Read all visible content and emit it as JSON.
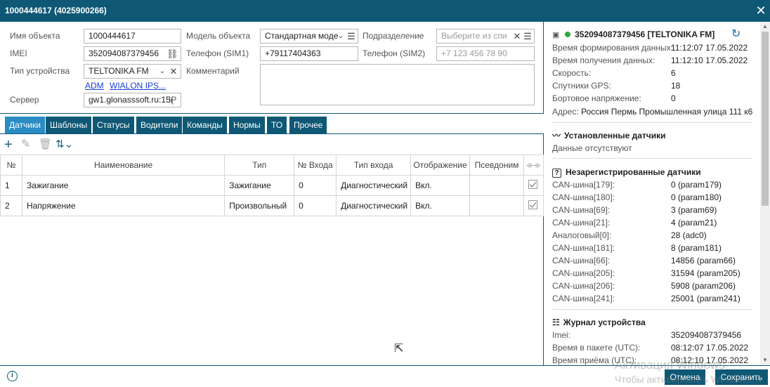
{
  "window": {
    "title": "1000444617 (4025900266)",
    "close": "✕"
  },
  "form": {
    "object_name_label": "Имя объекта",
    "object_name": "1000444617",
    "imei_label": "IMEI",
    "imei": "352094087379456",
    "device_type_label": "Тип устройства",
    "device_type": "TELTONIKA FM",
    "link_adm": "ADM",
    "link_wialon": "WIALON IPS...",
    "server_label": "Сервер",
    "server": "gw1.glonasssoft.ru:15(",
    "server_suffix": "IP",
    "model_label": "Модель объекта",
    "model": "Стандартная моде",
    "phone1_label": "Телефон (SIM1)",
    "phone1": "+79117404363",
    "comment_label": "Комментарий",
    "division_label": "Подразделение",
    "division_placeholder": "Выберите из спи",
    "phone2_label": "Телефон (SIM2)",
    "phone2_placeholder": "+7 123 456 78 90"
  },
  "tabs": [
    "Датчики",
    "Шаблоны",
    "Статусы",
    "Водители",
    "Команды",
    "Нормы",
    "ТО",
    "Прочее"
  ],
  "table": {
    "headers": [
      "№",
      "Наименование",
      "Тип",
      "№ Входа",
      "Тип входа",
      "Отображение",
      "Псевдоним"
    ],
    "rows": [
      [
        "1",
        "Зажигание",
        "Зажигание",
        "0",
        "Диагностический",
        "Вкл.",
        ""
      ],
      [
        "2",
        "Напряжение",
        "Произвольный",
        "0",
        "Диагностический",
        "Вкл.",
        ""
      ]
    ]
  },
  "right": {
    "device": "352094087379456 [TELTONIKA FM]",
    "status_color": "#2eaa3a",
    "info": [
      {
        "k": "Время формирования данных:",
        "v": "11:12:07 17.05.2022"
      },
      {
        "k": "Время получения данных:",
        "v": "11:12:10 17.05.2022"
      },
      {
        "k": "Скорость:",
        "v": "6"
      },
      {
        "k": "Спутники GPS:",
        "v": "18"
      },
      {
        "k": "Бортовое напряжение:",
        "v": "0"
      }
    ],
    "address_label": "Адрес:",
    "address": "Россия Пермь Промышленная улица 111 к6",
    "installed_title": "Установленные датчики",
    "installed_empty": "Данные отсутствуют",
    "unreg_title": "Незарегистрированные датчики",
    "unreg": [
      {
        "k": "CAN-шина[179]:",
        "v": "0 (param179)"
      },
      {
        "k": "CAN-шина[180]:",
        "v": "0 (param180)"
      },
      {
        "k": "CAN-шина[69]:",
        "v": "3 (param69)"
      },
      {
        "k": "CAN-шина[21]:",
        "v": "4 (param21)"
      },
      {
        "k": "Аналоговый[0]:",
        "v": "28 (adc0)"
      },
      {
        "k": "CAN-шина[181]:",
        "v": "8 (param181)"
      },
      {
        "k": "CAN-шина[66]:",
        "v": "14856 (param66)"
      },
      {
        "k": "CAN-шина[205]:",
        "v": "31594 (param205)"
      },
      {
        "k": "CAN-шина[206]:",
        "v": "5908 (param206)"
      },
      {
        "k": "CAN-шина[241]:",
        "v": "25001 (param241)"
      }
    ],
    "journal_title": "Журнал устройства",
    "journal": [
      {
        "k": "Imei:",
        "v": "352094087379456"
      },
      {
        "k": "Время в пакете (UTC):",
        "v": "08:12:07 17.05.2022"
      },
      {
        "k": "Время приёма (UTC):",
        "v": "08:12:10 17.05.2022"
      }
    ]
  },
  "footer": {
    "cancel": "Отмена",
    "save": "Сохранить"
  },
  "watermark": {
    "line1": "Активация Windows",
    "line2": "Чтобы активировать Windows, п"
  },
  "colors": {
    "header": "#0e5875",
    "active_tab": "#2b8cc4"
  }
}
